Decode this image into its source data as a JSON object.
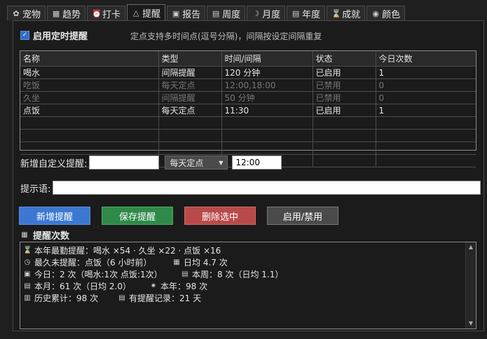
{
  "tabs": [
    {
      "label": "宠物",
      "icon": "paw-icon",
      "glyph": "✿",
      "active": false
    },
    {
      "label": "趋势",
      "icon": "trend-chart-icon",
      "glyph": "▦",
      "active": false
    },
    {
      "label": "打卡",
      "icon": "alarm-clock-icon",
      "glyph": "⏰",
      "active": false
    },
    {
      "label": "提醒",
      "icon": "bell-icon",
      "glyph": "△",
      "active": true
    },
    {
      "label": "报告",
      "icon": "report-icon",
      "glyph": "▣",
      "active": false
    },
    {
      "label": "周度",
      "icon": "calendar-week-icon",
      "glyph": "▤",
      "active": false
    },
    {
      "label": "月度",
      "icon": "moon-icon",
      "glyph": "☽",
      "active": false
    },
    {
      "label": "年度",
      "icon": "calendar-year-icon",
      "glyph": "▤",
      "active": false
    },
    {
      "label": "成就",
      "icon": "hourglass-icon",
      "glyph": "⌛",
      "active": false
    },
    {
      "label": "颜色",
      "icon": "palette-icon",
      "glyph": "◉",
      "active": false
    }
  ],
  "enable": {
    "label": "启用定时提醒",
    "checked": true
  },
  "hint": "定点支持多时间点(逗号分隔)，间隔按设定间隔重复",
  "table": {
    "headers": [
      "名称",
      "类型",
      "时间/间隔",
      "状态",
      "今日次数"
    ],
    "rows": [
      {
        "name": "喝水",
        "type": "间隔提醒",
        "time": "120 分钟",
        "status": "已启用",
        "count": "1",
        "enabled": true
      },
      {
        "name": "吃饭",
        "type": "每天定点",
        "time": "12:00,18:00",
        "status": "已禁用",
        "count": "0",
        "enabled": false
      },
      {
        "name": "久坐",
        "type": "间隔提醒",
        "time": "50 分钟",
        "status": "已禁用",
        "count": "0",
        "enabled": false
      },
      {
        "name": "点饭",
        "type": "每天定点",
        "time": "11:30",
        "status": "已启用",
        "count": "1",
        "enabled": true
      }
    ],
    "empty_rows": 4
  },
  "add": {
    "label": "新增自定义提醒:",
    "name_value": "",
    "type_selected": "每天定点",
    "time_value": "12:00"
  },
  "message": {
    "label": "提示语:",
    "value": ""
  },
  "buttons": {
    "add": "新增提醒",
    "save": "保存提醒",
    "delete": "删除选中",
    "toggle": "启用/禁用"
  },
  "stats": {
    "title": "提醒次数",
    "lines": [
      [
        {
          "icon": "hourglass-icon",
          "glyph": "⌛",
          "text": "本年最勤提醒：喝水 ×54 · 久坐 ×22 · 点饭 ×16"
        }
      ],
      [
        {
          "icon": "stopwatch-icon",
          "glyph": "◷",
          "text": "最久未提醒：点饭（6 小时前）"
        },
        {
          "icon": "chart-icon",
          "glyph": "▦",
          "text": "日均 4.7 次"
        }
      ],
      [
        {
          "icon": "calendar-today-icon",
          "glyph": "▣",
          "text": "今日：2 次（喝水:1次 点饭:1次）"
        },
        {
          "icon": "calendar-week-icon",
          "glyph": "▤",
          "text": "本周：8 次（日均 1.1）"
        }
      ],
      [
        {
          "icon": "calendar-month-icon",
          "glyph": "▤",
          "text": "本月：61 次（日均 2.0）"
        },
        {
          "icon": "calendar-year-icon",
          "glyph": "✷",
          "text": "本年：98 次"
        }
      ],
      [
        {
          "icon": "history-icon",
          "glyph": "▥",
          "text": "历史累计：98 次"
        },
        {
          "icon": "record-icon",
          "glyph": "▤",
          "text": "有提醒记录：21 天"
        }
      ]
    ]
  }
}
